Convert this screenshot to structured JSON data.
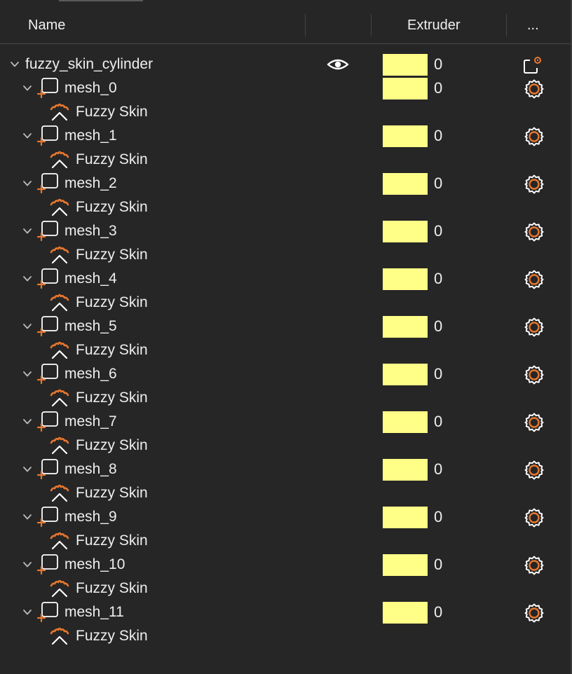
{
  "header": {
    "col_name": "Name",
    "col_visible": "",
    "col_extruder": "Extruder",
    "col_more": "..."
  },
  "colors": {
    "background": "#262626",
    "extruder_swatch": "#ffff88",
    "accent": "#e8772e"
  },
  "tree": {
    "root": {
      "name": "fuzzy_skin_cylinder",
      "extruder": "0",
      "visible_icon": "eye-icon",
      "settings_icon": "object-settings-icon"
    },
    "parts": [
      {
        "name": "mesh_0",
        "extruder": "0",
        "modifier": "Fuzzy Skin"
      },
      {
        "name": "mesh_1",
        "extruder": "0",
        "modifier": "Fuzzy Skin"
      },
      {
        "name": "mesh_2",
        "extruder": "0",
        "modifier": "Fuzzy Skin"
      },
      {
        "name": "mesh_3",
        "extruder": "0",
        "modifier": "Fuzzy Skin"
      },
      {
        "name": "mesh_4",
        "extruder": "0",
        "modifier": "Fuzzy Skin"
      },
      {
        "name": "mesh_5",
        "extruder": "0",
        "modifier": "Fuzzy Skin"
      },
      {
        "name": "mesh_6",
        "extruder": "0",
        "modifier": "Fuzzy Skin"
      },
      {
        "name": "mesh_7",
        "extruder": "0",
        "modifier": "Fuzzy Skin"
      },
      {
        "name": "mesh_8",
        "extruder": "0",
        "modifier": "Fuzzy Skin"
      },
      {
        "name": "mesh_9",
        "extruder": "0",
        "modifier": "Fuzzy Skin"
      },
      {
        "name": "mesh_10",
        "extruder": "0",
        "modifier": "Fuzzy Skin"
      },
      {
        "name": "mesh_11",
        "extruder": "0",
        "modifier": "Fuzzy Skin"
      }
    ]
  }
}
